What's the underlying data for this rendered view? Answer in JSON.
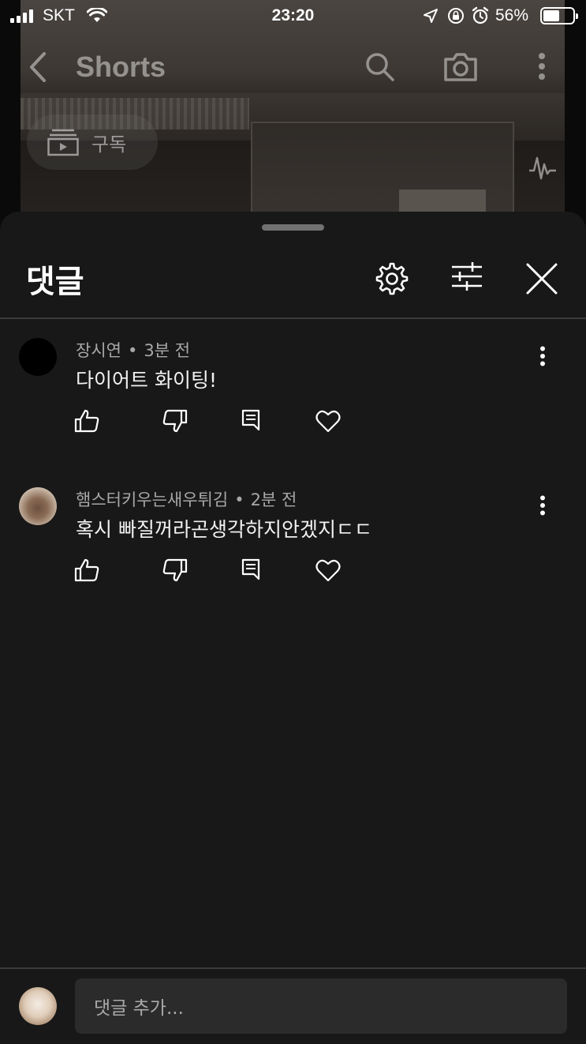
{
  "status_bar": {
    "carrier": "SKT",
    "time": "23:20",
    "battery": "56%",
    "battery_level": 0.56
  },
  "video": {
    "title": "Shorts",
    "subscribe_label": "구독"
  },
  "comments_sheet": {
    "title": "댓글",
    "comments": [
      {
        "author": "장시연",
        "time": "3분 전",
        "text": "다이어트 화이팅!"
      },
      {
        "author": "햄스터키우는새우튀김",
        "time": "2분 전",
        "text": "혹시 빠질꺼라곤생각하지안겠지ㄷㄷ"
      }
    ],
    "input_placeholder": "댓글 추가..."
  },
  "colors": {
    "sheet_bg": "#181818",
    "input_bg": "#2b2b2b",
    "meta_text": "#a8a8a8"
  }
}
